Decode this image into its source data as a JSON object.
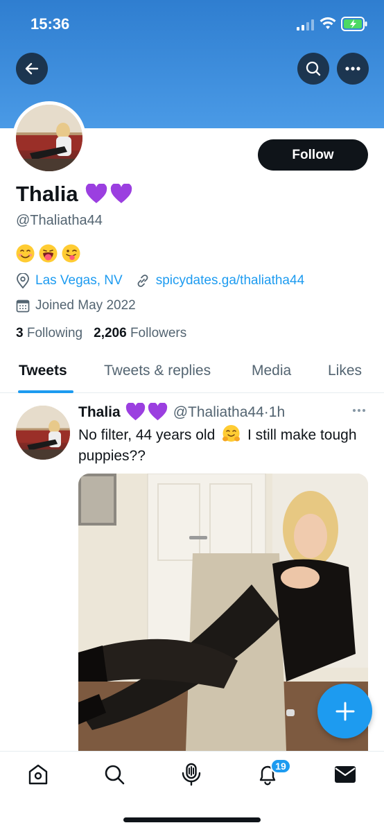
{
  "status_bar": {
    "time": "15:36"
  },
  "header": {
    "back": "back-arrow",
    "search": "search",
    "more": "more"
  },
  "profile": {
    "follow_label": "Follow",
    "name": "Thalia",
    "handle": "@Thaliatha44",
    "bio_emojis": [
      "smiling-face",
      "tongue-out",
      "winking-tongue"
    ],
    "location": "Las Vegas, NV",
    "website": "spicydates.ga/thaliatha44",
    "joined": "Joined May 2022",
    "following_count": "3",
    "following_label": "Following",
    "followers_count": "2,206",
    "followers_label": "Followers"
  },
  "tabs": [
    {
      "label": "Tweets",
      "active": true
    },
    {
      "label": "Tweets & replies",
      "active": false
    },
    {
      "label": "Media",
      "active": false
    },
    {
      "label": "Likes",
      "active": false
    }
  ],
  "tweet": {
    "name": "Thalia",
    "handle": "@Thaliatha44",
    "sep": "·",
    "time": "1h",
    "text_before": "No filter, 44 years old",
    "text_after": "I still make tough puppies??"
  },
  "bottom_nav": {
    "notifications_badge": "19",
    "items": [
      "home",
      "search",
      "spaces",
      "notifications",
      "messages"
    ]
  },
  "colors": {
    "accent": "#1d9bf0",
    "header": "#3b8ddc",
    "heart": "#9b3fe0"
  }
}
